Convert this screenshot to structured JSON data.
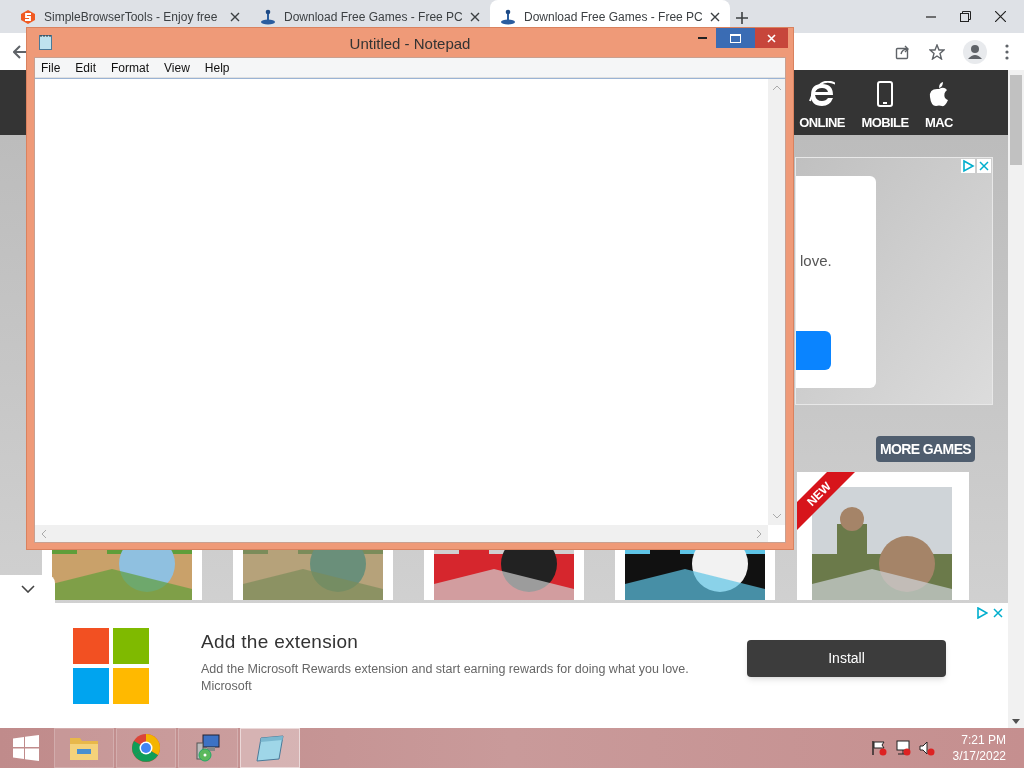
{
  "browser_tabs": [
    {
      "title": "SimpleBrowserTools - Enjoy free",
      "selected": false
    },
    {
      "title": "Download Free Games - Free PC",
      "selected": false
    },
    {
      "title": "Download Free Games - Free PC",
      "selected": true
    }
  ],
  "site_nav": [
    {
      "label": "ONLINE"
    },
    {
      "label": "MOBILE"
    },
    {
      "label": "MAC"
    }
  ],
  "side_ad": {
    "text": "love."
  },
  "more_games": "MORE GAMES",
  "games": [
    {
      "kind": "picture"
    },
    {
      "kind": "picture"
    },
    {
      "kind": "picture"
    },
    {
      "kind": "picture"
    },
    {
      "kind": "picture",
      "badge": "NEW"
    }
  ],
  "bottom_ad": {
    "title": "Add the extension",
    "body": "Add the Microsoft Rewards extension and start earning rewards for doing what you love. Microsoft",
    "button": "Install"
  },
  "notepad": {
    "title": "Untitled - Notepad",
    "menu": [
      "File",
      "Edit",
      "Format",
      "View",
      "Help"
    ]
  },
  "taskbar": {
    "apps": [
      {
        "selected": false
      },
      {
        "selected": false
      },
      {
        "selected": false
      },
      {
        "selected": true
      }
    ],
    "time": "7:21 PM",
    "date": "3/17/2022"
  }
}
